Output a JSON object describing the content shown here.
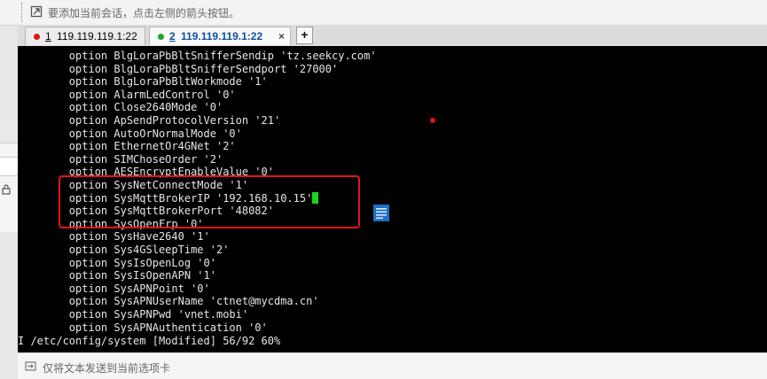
{
  "hint_bar": {
    "text": "要添加当前会话，点击左侧的箭头按钮。"
  },
  "tabs": [
    {
      "number": "1",
      "title": "119.119.119.1:22",
      "dot_color": "#e0141b",
      "active": false
    },
    {
      "number": "2",
      "title": "119.119.119.1:22",
      "dot_color": "#1aa52a",
      "active": true,
      "close_label": "×"
    }
  ],
  "new_tab_label": "+",
  "terminal": {
    "lines": [
      "        option BlgLoraPbBltSnifferSendip 'tz.seekcy.com'",
      "        option BlgLoraPbBltSnifferSendport '27000'",
      "        option BlgLoraPbBltWorkmode '1'",
      "        option AlarmLedControl '0'",
      "        option Close2640Mode '0'",
      "        option ApSendProtocolVersion '21'",
      "        option AutoOrNormalMode '0'",
      "        option EthernetOr4GNet '2'",
      "        option SIMChoseOrder '2'",
      "        option AESEncryptEnableValue '0'",
      "        option SysNetConnectMode '1'",
      "        option SysMqttBrokerIP '192.168.10.15'",
      "        option SysMqttBrokerPort '48082'",
      "        option SysOpenFrp '0'",
      "        option SysHave2640 '1'",
      "        option Sys4GSleepTime '2'",
      "        option SysIsOpenLog '0'",
      "        option SysIsOpenAPN '1'",
      "        option SysAPNPoint '0'",
      "        option SysAPNUserName 'ctnet@mycdma.cn'",
      "        option SysAPNPwd 'vnet.mobi'",
      "        option SysAPNAuthentication '0'"
    ],
    "status_line": "I /etc/config/system [Modified] 56/92 60%",
    "cursor_color": "#1bd41b",
    "highlight_color": "#e2141b"
  },
  "bottom_bar": {
    "text": "仅将文本发送到当前选项卡"
  }
}
